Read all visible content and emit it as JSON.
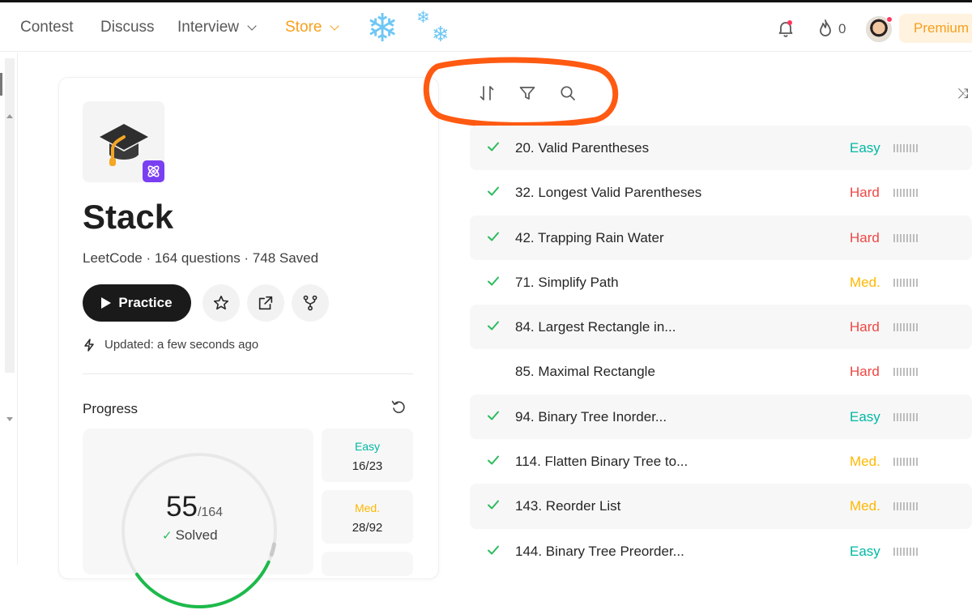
{
  "nav": {
    "items": [
      {
        "label": "Contest"
      },
      {
        "label": "Discuss"
      },
      {
        "label": "Interview"
      },
      {
        "label": "Store"
      }
    ],
    "streak": "0",
    "premium": "Premium"
  },
  "list_header": {
    "title": "Stack",
    "subtitle": "LeetCode · 164 questions · 748 Saved",
    "practice_label": "Practice",
    "updated": "Updated: a few seconds ago"
  },
  "progress": {
    "label": "Progress",
    "solved": 55,
    "solved_text": "55",
    "total_text": "/164",
    "solved_label": "Solved",
    "fraction": 0.335,
    "easy": {
      "label": "Easy",
      "value": "16/23"
    },
    "medium": {
      "label": "Med.",
      "value": "28/92"
    }
  },
  "colors": {
    "easy": "#00b8a3",
    "medium": "#ffb800",
    "hard": "#ef4743",
    "check": "#2cbb5d",
    "annotation": "#ff5a12",
    "accent": "#f89f1b"
  },
  "toolbar": {
    "icons": [
      "sort-icon",
      "filter-icon",
      "search-icon"
    ]
  },
  "questions": [
    {
      "title": "20. Valid Parentheses",
      "difficulty": "Easy",
      "solved": true
    },
    {
      "title": "32. Longest Valid Parentheses",
      "difficulty": "Hard",
      "solved": true
    },
    {
      "title": "42. Trapping Rain Water",
      "difficulty": "Hard",
      "solved": true
    },
    {
      "title": "71. Simplify Path",
      "difficulty": "Med.",
      "solved": true
    },
    {
      "title": "84. Largest Rectangle in...",
      "difficulty": "Hard",
      "solved": true
    },
    {
      "title": "85. Maximal Rectangle",
      "difficulty": "Hard",
      "solved": false
    },
    {
      "title": "94. Binary Tree Inorder...",
      "difficulty": "Easy",
      "solved": true
    },
    {
      "title": "114. Flatten Binary Tree to...",
      "difficulty": "Med.",
      "solved": true
    },
    {
      "title": "143. Reorder List",
      "difficulty": "Med.",
      "solved": true
    },
    {
      "title": "144. Binary Tree Preorder...",
      "difficulty": "Easy",
      "solved": true
    }
  ]
}
